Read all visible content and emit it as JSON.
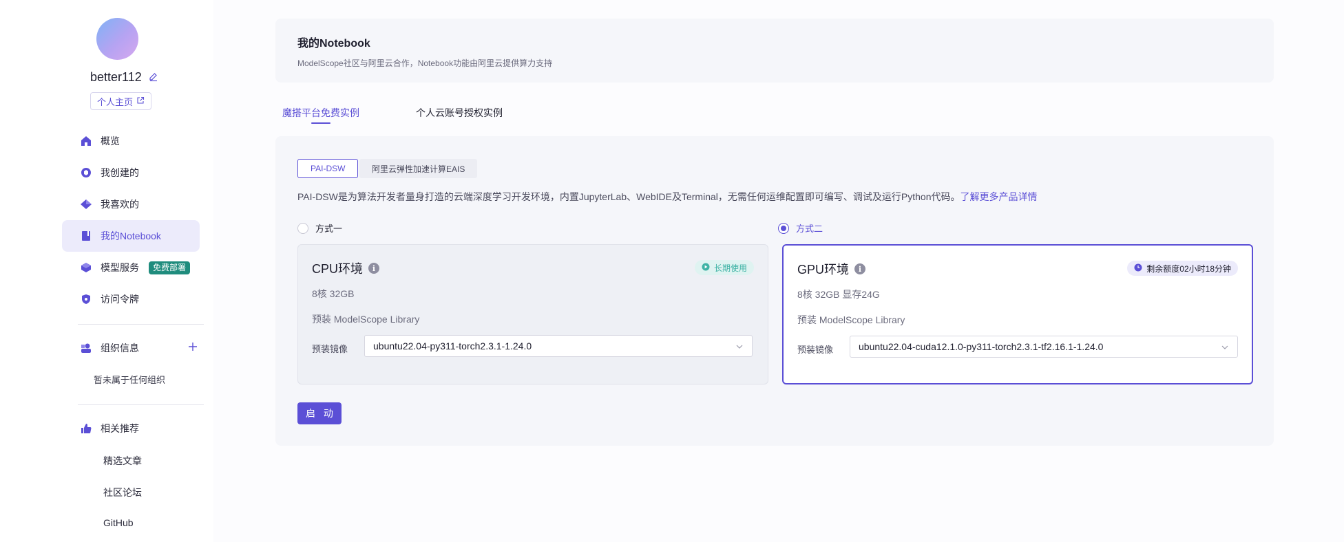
{
  "user": {
    "name": "better112",
    "home_label": "个人主页"
  },
  "nav": {
    "overview": "概览",
    "created": "我创建的",
    "liked": "我喜欢的",
    "notebook": "我的Notebook",
    "model_service": "模型服务",
    "model_service_badge": "免费部署",
    "token": "访问令牌"
  },
  "org": {
    "title": "组织信息",
    "empty": "暂未属于任何组织"
  },
  "recommend": {
    "title": "相关推荐",
    "articles": "精选文章",
    "forum": "社区论坛",
    "github": "GitHub"
  },
  "header": {
    "title": "我的Notebook",
    "subtitle": "ModelScope社区与阿里云合作，Notebook功能由阿里云提供算力支持"
  },
  "tabs": {
    "free": "魔搭平台免费实例",
    "personal": "个人云账号授权实例"
  },
  "segments": {
    "dsw": "PAI-DSW",
    "eais": "阿里云弹性加速计算EAIS"
  },
  "description": {
    "text": "PAI-DSW是为算法开发者量身打造的云端深度学习开发环境，内置JupyterLab、WebIDE及Terminal，无需任何运维配置即可编写、调试及运行Python代码。",
    "link": "了解更多产品详情"
  },
  "options": {
    "one": {
      "label": "方式一",
      "checked": false
    },
    "two": {
      "label": "方式二",
      "checked": true
    }
  },
  "cpu": {
    "title": "CPU环境",
    "badge": "长期使用",
    "spec": "8核 32GB",
    "library": "预装 ModelScope Library",
    "image_label": "预装镜像",
    "image_value": "ubuntu22.04-py311-torch2.3.1-1.24.0"
  },
  "gpu": {
    "title": "GPU环境",
    "badge": "剩余额度02小时18分钟",
    "spec": "8核 32GB 显存24G",
    "library": "预装 ModelScope Library",
    "image_label": "预装镜像",
    "image_value": "ubuntu22.04-cuda12.1.0-py311-torch2.3.1-tf2.16.1-1.24.0"
  },
  "start_button": "启 动",
  "colors": {
    "accent": "#5b4fd6",
    "badge_green": "#1f8c7d",
    "panel_bg": "#f5f6fa"
  },
  "icons": [
    "edit-icon",
    "external-link-icon",
    "home-icon",
    "cube-icon",
    "diamond-icon",
    "notebook-icon",
    "model-icon",
    "shield-icon",
    "org-icon",
    "plus-icon",
    "thumb-up-icon",
    "info-icon",
    "play-icon",
    "clock-icon",
    "chevron-down-icon"
  ]
}
